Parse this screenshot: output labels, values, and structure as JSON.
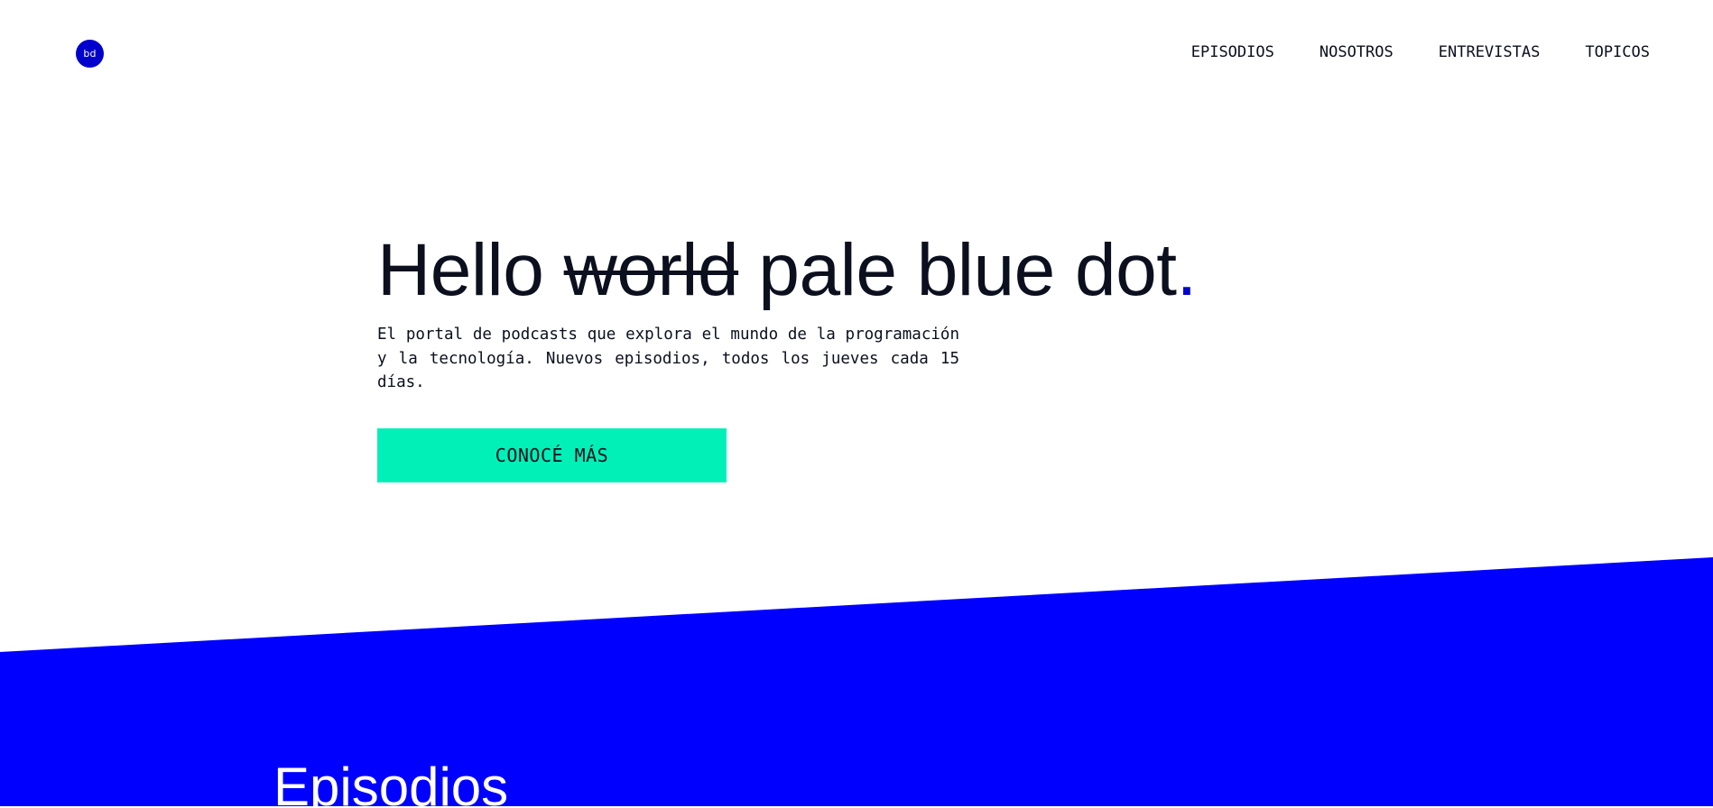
{
  "brand": {
    "logo_text": "bd",
    "accent_color": "#0000cc",
    "cta_color": "#00f0b8",
    "band_color": "#0000ff"
  },
  "nav": {
    "items": [
      {
        "label": "EPISODIOS"
      },
      {
        "label": "NOSOTROS"
      },
      {
        "label": "ENTREVISTAS"
      },
      {
        "label": "TOPICOS"
      }
    ]
  },
  "hero": {
    "title_prefix": "Hello ",
    "title_struck": "world",
    "title_suffix": " pale blue dot",
    "title_dot": ".",
    "subtitle": "El portal de podcasts que explora el mundo de la programación y la tecnología. Nuevos episodios, todos los jueves cada 15 días.",
    "cta_label": "CONOCÉ MÁS"
  },
  "episodes": {
    "title": "Episodios"
  }
}
